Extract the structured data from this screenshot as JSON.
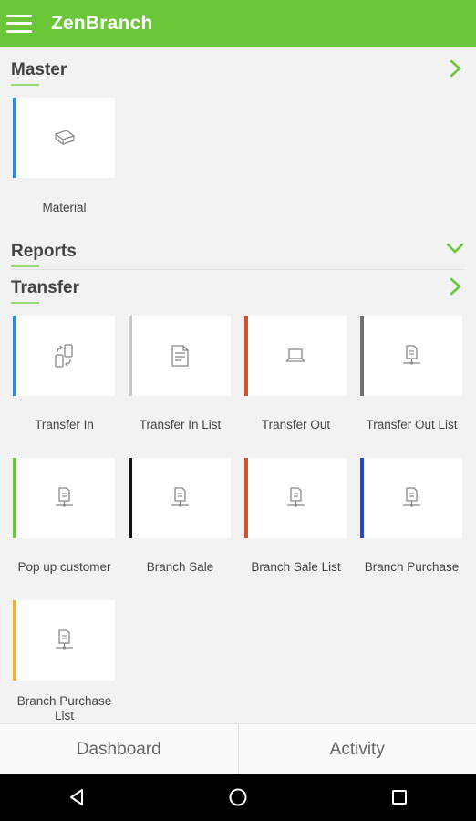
{
  "app": {
    "title": "ZenBranch",
    "accent_color": "#6cc63a"
  },
  "sections": {
    "master": {
      "title": "Master",
      "chevron": "chevron-right-icon",
      "items": [
        {
          "label": "Material",
          "icon": "eraser-icon",
          "color": "#2a8dd4"
        }
      ]
    },
    "reports": {
      "title": "Reports",
      "chevron": "chevron-down-icon"
    },
    "transfer": {
      "title": "Transfer",
      "chevron": "chevron-right-icon",
      "items": [
        {
          "label": "Transfer In",
          "icon": "transfer-phones-icon",
          "color": "#2a8dd4"
        },
        {
          "label": "Transfer In List",
          "icon": "document-list-icon",
          "color": "#c6c6c6"
        },
        {
          "label": "Transfer Out",
          "icon": "laptop-icon",
          "color": "#d2522e"
        },
        {
          "label": "Transfer Out List",
          "icon": "document-network-icon",
          "color": "#707070"
        },
        {
          "label": "Pop up customer",
          "icon": "document-network-icon",
          "color": "#6cc63a"
        },
        {
          "label": "Branch Sale",
          "icon": "document-network-icon",
          "color": "#111111"
        },
        {
          "label": "Branch Sale List",
          "icon": "document-network-icon",
          "color": "#d2522e"
        },
        {
          "label": "Branch Purchase",
          "icon": "document-network-icon",
          "color": "#2346c8"
        },
        {
          "label": "Branch Purchase List",
          "icon": "document-network-icon",
          "color": "#e8b339"
        }
      ]
    }
  },
  "bottom_nav": {
    "dashboard": "Dashboard",
    "activity": "Activity"
  },
  "system_nav": {
    "back": "back-icon",
    "home": "home-icon",
    "recents": "recents-icon"
  }
}
